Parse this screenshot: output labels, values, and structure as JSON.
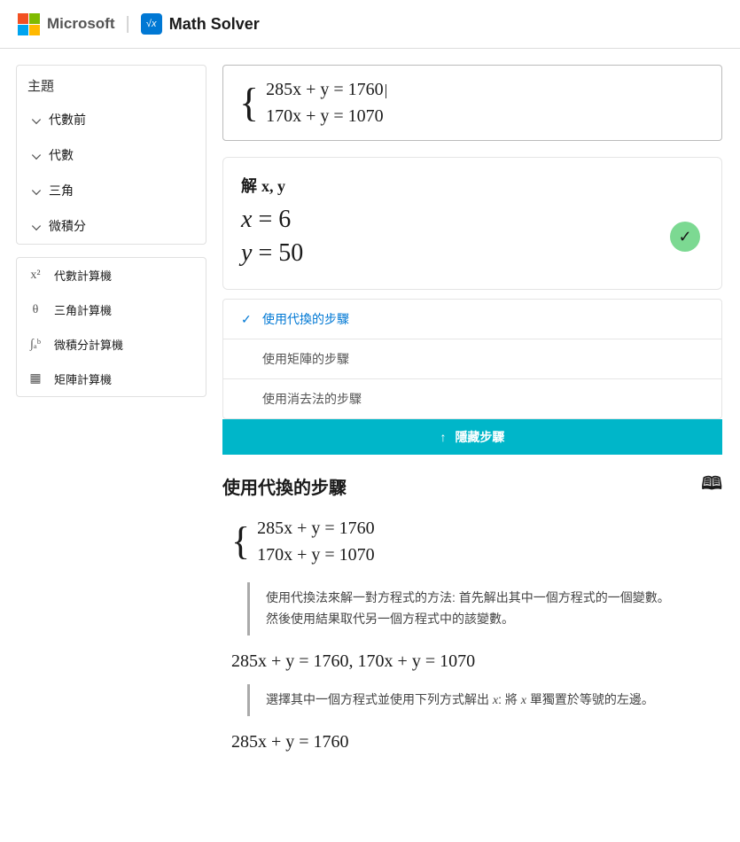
{
  "header": {
    "brand": "Microsoft",
    "app": "Math Solver"
  },
  "sidebar": {
    "topics_heading": "主題",
    "topics": [
      {
        "label": "代數前"
      },
      {
        "label": "代數"
      },
      {
        "label": "三角"
      },
      {
        "label": "微積分"
      }
    ],
    "calcs": [
      {
        "icon": "x²",
        "label": "代數計算機"
      },
      {
        "icon": "θ",
        "label": "三角計算機"
      },
      {
        "icon": "∫ₐᵇ",
        "label": "微積分計算機"
      },
      {
        "icon": "▦",
        "label": "矩陣計算機"
      }
    ]
  },
  "input": {
    "line1": "285x + y = 1760",
    "line2": "170x + y = 1070"
  },
  "result": {
    "solve_label": "解",
    "vars": "x, y",
    "line1_var": "x",
    "line1_val": "= 6",
    "line2_var": "y",
    "line2_val": "= 50"
  },
  "methods": [
    {
      "label": "使用代換的步驟",
      "active": true
    },
    {
      "label": "使用矩陣的步驟",
      "active": false
    },
    {
      "label": "使用消去法的步驟",
      "active": false
    }
  ],
  "hide_steps_label": "隱藏步驟",
  "steps": {
    "title": "使用代換的步驟",
    "system_line1": "285x + y = 1760",
    "system_line2": "170x + y = 1070",
    "explain1a": "使用代換法來解一對方程式的方法: 首先解出其中一個方程式的一個變數。",
    "explain1b": "然後使用結果取代另一個方程式中的該變數。",
    "eq_joined": "285x + y = 1760, 170x + y = 1070",
    "explain2_prefix": "選擇其中一個方程式並使用下列方式解出 ",
    "explain2_var1": "x",
    "explain2_mid": ": 將 ",
    "explain2_var2": "x",
    "explain2_suffix": " 單獨置於等號的左邊。",
    "eq_single": "285x + y = 1760"
  }
}
